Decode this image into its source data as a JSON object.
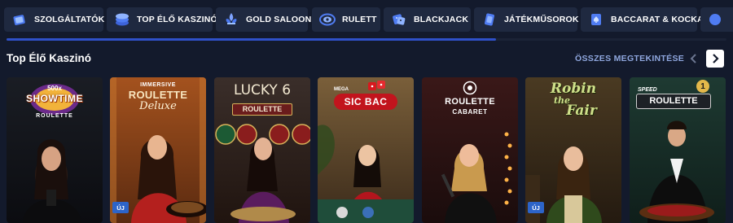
{
  "tabs": [
    {
      "label": "SZOLGÁLTATÓK",
      "icon": "providers-icon"
    },
    {
      "label": "TOP ÉLŐ KASZINÓ",
      "icon": "chips-icon"
    },
    {
      "label": "GOLD SALOON",
      "icon": "fleur-de-lis-icon"
    },
    {
      "label": "RULETT",
      "icon": "roulette-icon"
    },
    {
      "label": "BLACKJACK",
      "icon": "dice-icon"
    },
    {
      "label": "JÁTÉKMŰSOROK",
      "icon": "card-icon"
    },
    {
      "label": "BACCARAT & KOCKA",
      "icon": "card-spade-icon"
    }
  ],
  "scroll_progress_percent": 68,
  "section": {
    "title": "Top Élő Kaszinó",
    "see_all": "ÖSSZES MEGTEKINTÉSE"
  },
  "games": [
    {
      "logo_lines": [
        "500x",
        "SHOWTIME",
        "ROULETTE"
      ],
      "badge": ""
    },
    {
      "logo_lines": [
        "IMMERSIVE",
        "ROULETTE",
        "Deluxe"
      ],
      "badge": "ÚJ"
    },
    {
      "logo_lines": [
        "LUCKY 6",
        "ROULETTE"
      ],
      "badge": ""
    },
    {
      "logo_lines": [
        "MEGA",
        "SIC BAC"
      ],
      "badge": ""
    },
    {
      "logo_lines": [
        "ROULETTE",
        "CABARET"
      ],
      "badge": ""
    },
    {
      "logo_lines": [
        "Robin",
        "the",
        "Fair"
      ],
      "badge": "ÚJ"
    },
    {
      "logo_lines": [
        "SPEED",
        "ROULETTE",
        "1"
      ],
      "badge": ""
    }
  ],
  "colors": {
    "background": "#131a2c",
    "tab": "#1f2940",
    "accent": "#2f51c9",
    "link": "#8fa7de",
    "badge": "#2d64c8"
  }
}
